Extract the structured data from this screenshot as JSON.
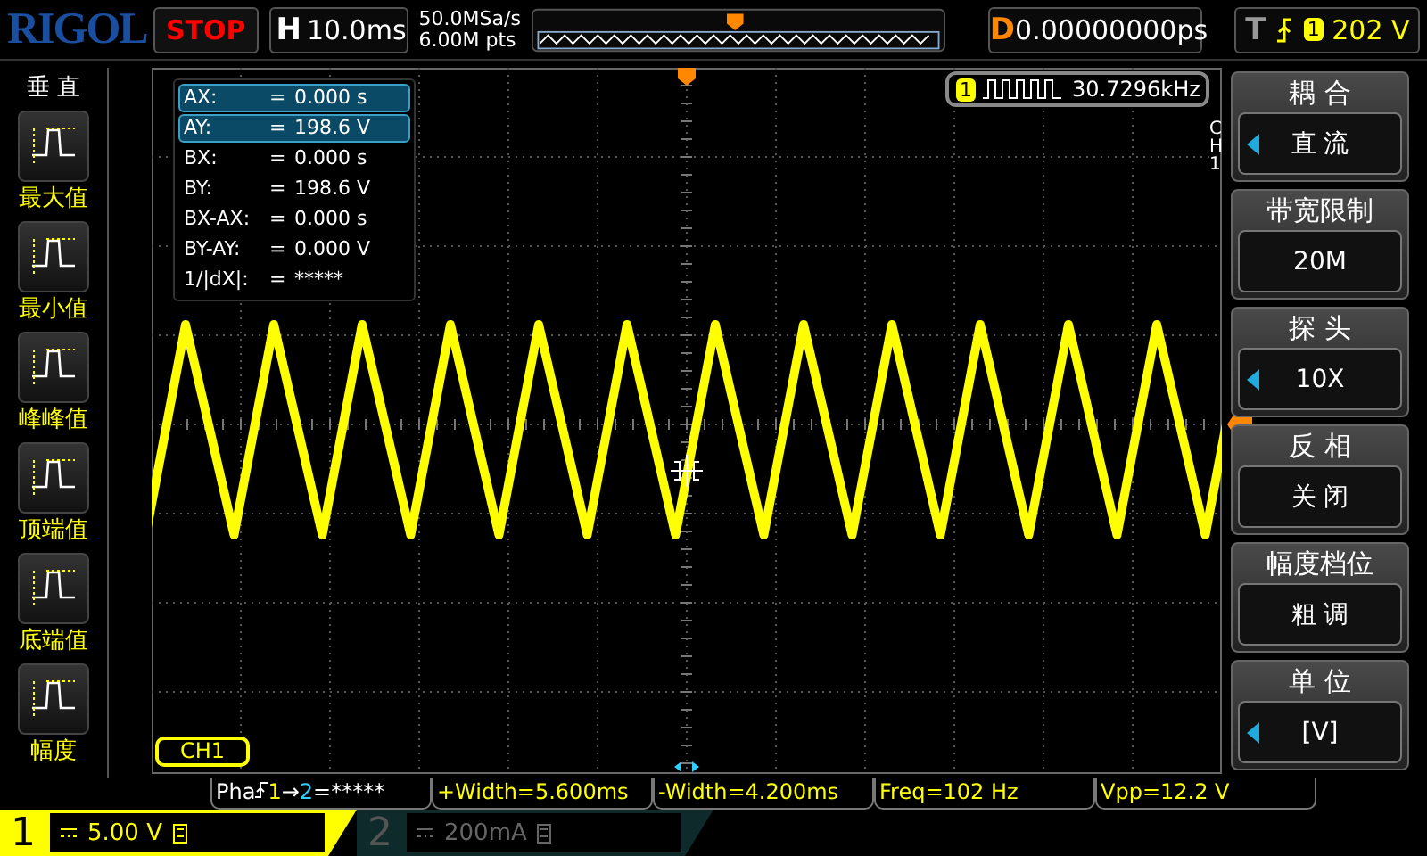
{
  "top_bar": {
    "logo": "RIGOL",
    "run_state": "STOP",
    "timebase": {
      "label": "H",
      "value": "10.0ms"
    },
    "sample_rate": "50.0MSa/s",
    "memory_depth": "6.00M pts",
    "delay": {
      "label": "D",
      "value": "0.00000000ps"
    },
    "trigger": {
      "label": "T",
      "source": "1",
      "level": "202 V"
    }
  },
  "left_menu": {
    "title": "垂 直",
    "items": [
      {
        "label": "最大值"
      },
      {
        "label": "最小值"
      },
      {
        "label": "峰峰值"
      },
      {
        "label": "顶端值"
      },
      {
        "label": "底端值"
      },
      {
        "label": "幅度"
      }
    ]
  },
  "cursor_table": [
    {
      "name": "AX:",
      "eq": "=",
      "value": "0.000 s",
      "selected": true
    },
    {
      "name": "AY:",
      "eq": "=",
      "value": "198.6 V",
      "selected": true
    },
    {
      "name": "BX:",
      "eq": "=",
      "value": "0.000 s",
      "selected": false
    },
    {
      "name": "BY:",
      "eq": "=",
      "value": "198.6 V",
      "selected": false
    },
    {
      "name": "BX-AX:",
      "eq": "=",
      "value": "0.000 s",
      "selected": false
    },
    {
      "name": "BY-AY:",
      "eq": "=",
      "value": "0.000 V",
      "selected": false
    },
    {
      "name": "1/|dX|:",
      "eq": "=",
      "value": "*****",
      "selected": false
    }
  ],
  "counter": {
    "channel": "1",
    "value": "30.7296kHz"
  },
  "grid_channel_label": "CH1",
  "right_menu": {
    "channel_tab": "CH1",
    "items": [
      {
        "title": "耦 合",
        "value": "直 流",
        "has_arrow": true
      },
      {
        "title": "带宽限制",
        "value": "20M",
        "has_arrow": false
      },
      {
        "title": "探 头",
        "value": "10X",
        "has_arrow": true
      },
      {
        "title": "反 相",
        "value": "关 闭",
        "has_arrow": false
      },
      {
        "title": "幅度档位",
        "value": "粗 调",
        "has_arrow": false
      },
      {
        "title": "单 位",
        "value": "[V]",
        "has_arrow": true
      }
    ]
  },
  "measurements": [
    {
      "kind": "phase",
      "name": "Pha",
      "from": "1",
      "arrow": "→",
      "to": "2",
      "value": "=*****"
    },
    {
      "kind": "plain",
      "text": "+Width=5.600ms"
    },
    {
      "kind": "plain",
      "text": "-Width=4.200ms"
    },
    {
      "kind": "plain",
      "text": "Freq=102 Hz"
    },
    {
      "kind": "plain",
      "text": "Vpp=12.2 V"
    }
  ],
  "channels": [
    {
      "number": "1",
      "scale": "5.00 V",
      "selected": true
    },
    {
      "number": "2",
      "scale": "200mA",
      "selected": false
    }
  ]
}
